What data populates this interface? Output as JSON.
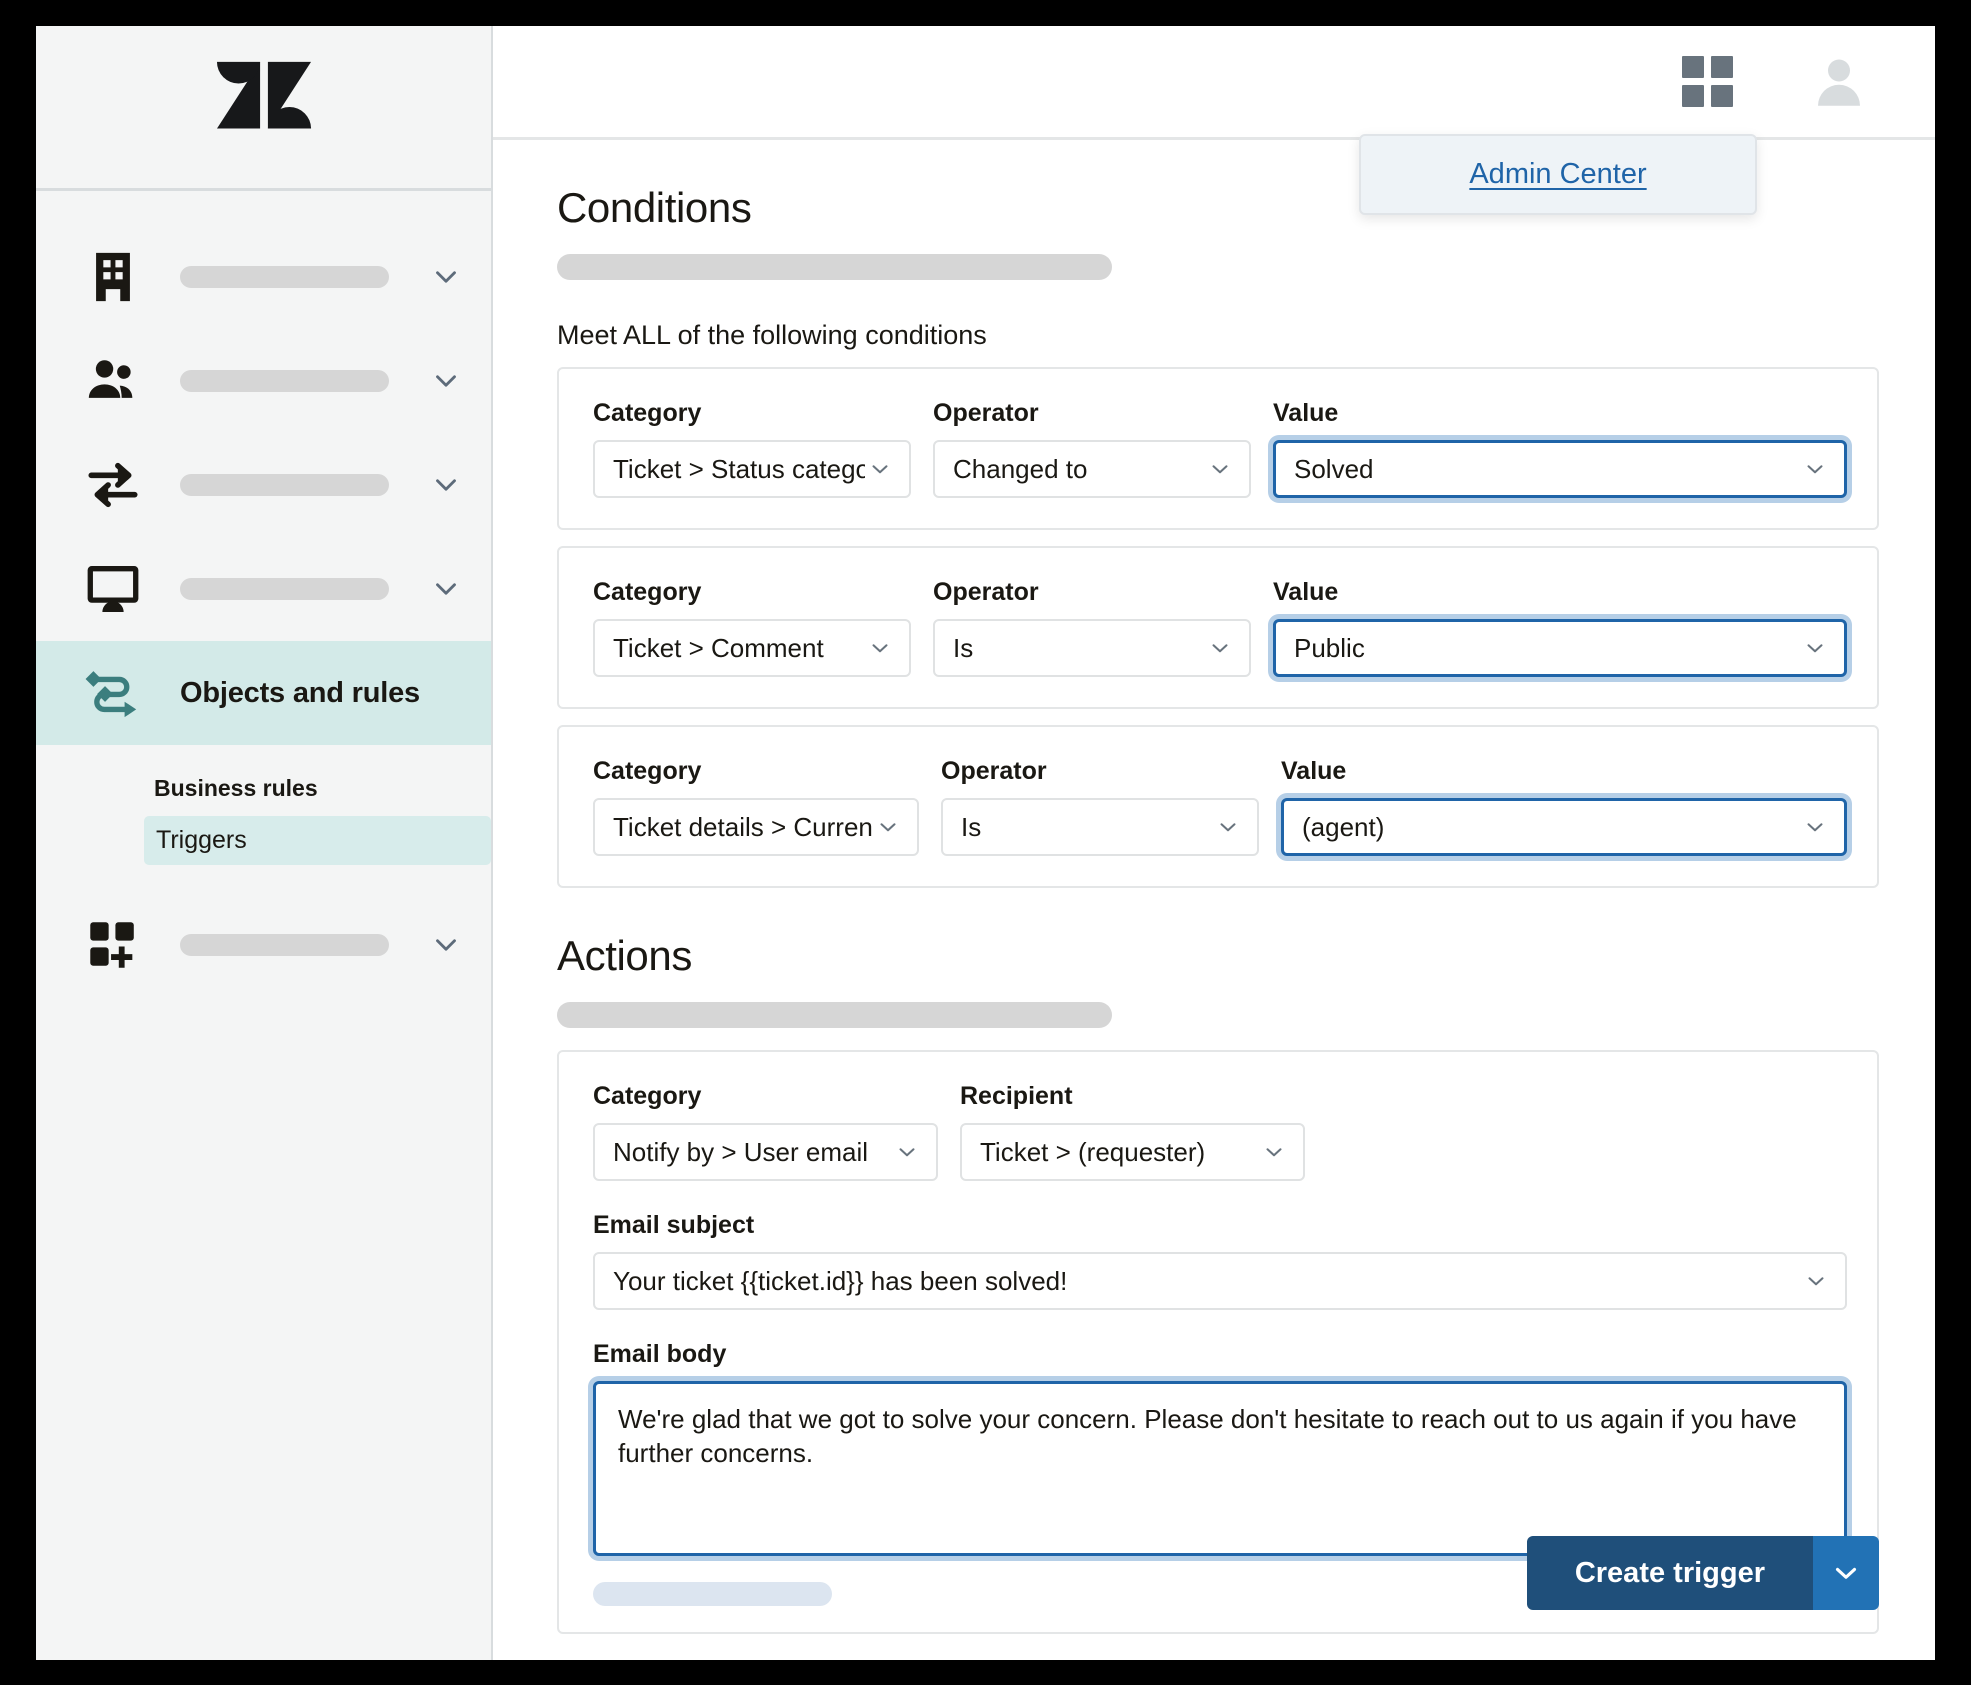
{
  "sidebar": {
    "logo_icon": "zendesk-logo",
    "nav_items": [
      {
        "icon": "building-icon",
        "label": "",
        "skeleton": true
      },
      {
        "icon": "people-icon",
        "label": "",
        "skeleton": true
      },
      {
        "icon": "arrows-exchange-icon",
        "label": "",
        "skeleton": true
      },
      {
        "icon": "monitor-icon",
        "label": "",
        "skeleton": true
      }
    ],
    "active_item": {
      "icon": "objects-rules-icon",
      "label": "Objects and rules"
    },
    "sub_header": "Business rules",
    "sub_item": "Triggers",
    "bottom_item": {
      "icon": "apps-add-icon",
      "label": "",
      "skeleton": true
    }
  },
  "topbar": {
    "grid_icon": "grid-apps-icon",
    "avatar_icon": "user-avatar-icon",
    "popup_link": "Admin Center"
  },
  "conditions": {
    "title": "Conditions",
    "meet_text": "Meet ALL of the following conditions",
    "labels": {
      "category": "Category",
      "operator": "Operator",
      "value": "Value"
    },
    "rows": [
      {
        "category": "Ticket > Status category",
        "operator": "Changed to",
        "value": "Solved"
      },
      {
        "category": "Ticket > Comment",
        "operator": "Is",
        "value": "Public"
      },
      {
        "category": "Ticket details > Current user",
        "operator": "Is",
        "value": "(agent)"
      }
    ]
  },
  "actions": {
    "title": "Actions",
    "labels": {
      "category": "Category",
      "recipient": "Recipient",
      "email_subject": "Email subject",
      "email_body": "Email body"
    },
    "category_value": "Notify by > User email",
    "recipient_value": "Ticket > (requester)",
    "email_subject_value": "Your ticket {{ticket.id}} has been solved!",
    "email_body_value": "We're glad that we got to solve your concern. Please don't hesitate to reach out to us again if you have further concerns."
  },
  "footer": {
    "create_label": "Create trigger",
    "split_icon": "chevron-down-icon"
  },
  "colors": {
    "accent_teal": "#d3eae8",
    "teal_icon": "#3b7e7e",
    "focus_blue": "#1f64a8",
    "primary_button": "#1f4f7a",
    "split_button": "#2272b5",
    "link_blue": "#1f64a8"
  }
}
